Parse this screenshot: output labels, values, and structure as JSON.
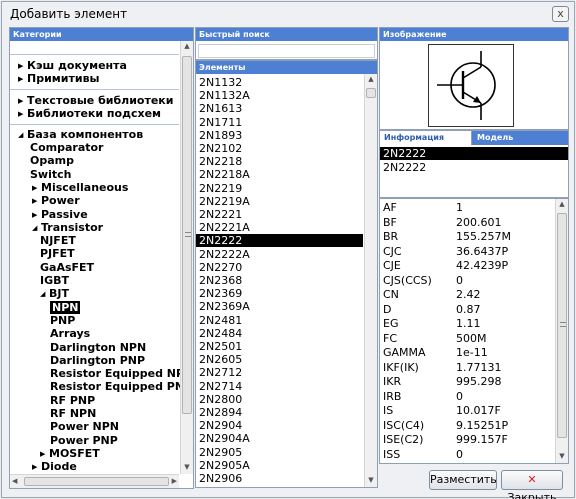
{
  "window": {
    "title": "Добавить элемент",
    "close_glyph": "x"
  },
  "categories": {
    "header": "Категории",
    "top_items": [
      {
        "label": "Кэш документа"
      },
      {
        "label": "Примитивы"
      },
      {
        "label": "Текстовые библиотеки"
      },
      {
        "label": "Библиотеки подсхем"
      }
    ],
    "root": {
      "label": "База компонентов"
    },
    "tree": [
      {
        "label": "Comparator",
        "arrow": ""
      },
      {
        "label": "Opamp",
        "arrow": ""
      },
      {
        "label": "Switch",
        "arrow": ""
      },
      {
        "label": "Miscellaneous",
        "arrow": "▶"
      },
      {
        "label": "Power",
        "arrow": "▶"
      },
      {
        "label": "Passive",
        "arrow": "▶"
      },
      {
        "label": "Transistor",
        "arrow": "◢"
      },
      {
        "label": "NJFET",
        "arrow": ""
      },
      {
        "label": "PJFET",
        "arrow": ""
      },
      {
        "label": "GaAsFET",
        "arrow": ""
      },
      {
        "label": "IGBT",
        "arrow": ""
      },
      {
        "label": "BJT",
        "arrow": "◢"
      },
      {
        "label": "NPN",
        "arrow": ""
      },
      {
        "label": "PNP",
        "arrow": ""
      },
      {
        "label": "Arrays",
        "arrow": ""
      },
      {
        "label": "Darlington NPN",
        "arrow": ""
      },
      {
        "label": "Darlington PNP",
        "arrow": ""
      },
      {
        "label": "Resistor Equipped NPN",
        "arrow": ""
      },
      {
        "label": "Resistor Equipped PNP",
        "arrow": ""
      },
      {
        "label": "RF PNP",
        "arrow": ""
      },
      {
        "label": "RF NPN",
        "arrow": ""
      },
      {
        "label": "Power NPN",
        "arrow": ""
      },
      {
        "label": "Power PNP",
        "arrow": ""
      },
      {
        "label": "MOSFET",
        "arrow": "▶"
      },
      {
        "label": "Diode",
        "arrow": "▶"
      }
    ]
  },
  "search": {
    "header": "Быстрый поиск",
    "value": ""
  },
  "elements": {
    "header": "Элементы",
    "selected": "2N2222",
    "items": [
      "2N1132",
      "2N1132A",
      "2N1613",
      "2N1711",
      "2N1893",
      "2N2102",
      "2N2218",
      "2N2218A",
      "2N2219",
      "2N2219A",
      "2N2221",
      "2N2221A",
      "2N2222",
      "2N2222A",
      "2N2270",
      "2N2368",
      "2N2369",
      "2N2369A",
      "2N2481",
      "2N2484",
      "2N2501",
      "2N2605",
      "2N2712",
      "2N2714",
      "2N2800",
      "2N2894",
      "2N2904",
      "2N2904A",
      "2N2905",
      "2N2905A",
      "2N2906"
    ]
  },
  "image": {
    "header": "Изображение",
    "icon": "npn-transistor-symbol"
  },
  "info": {
    "tabs": [
      {
        "label": "Информация"
      },
      {
        "label": "Модель"
      }
    ],
    "lines": [
      "2N2222",
      "2N2222"
    ]
  },
  "params": [
    {
      "k": "AF",
      "v": "1"
    },
    {
      "k": "BF",
      "v": "200.601"
    },
    {
      "k": "BR",
      "v": "155.257M"
    },
    {
      "k": "CJC",
      "v": "36.6437P"
    },
    {
      "k": "CJE",
      "v": "42.4239P"
    },
    {
      "k": "CJS(CCS)",
      "v": "0"
    },
    {
      "k": "CN",
      "v": "2.42"
    },
    {
      "k": "D",
      "v": "0.87"
    },
    {
      "k": "EG",
      "v": "1.11"
    },
    {
      "k": "FC",
      "v": "500M"
    },
    {
      "k": "GAMMA",
      "v": "1e-11"
    },
    {
      "k": "IKF(IK)",
      "v": "1.77131"
    },
    {
      "k": "IKR",
      "v": "995.298"
    },
    {
      "k": "IRB",
      "v": "0"
    },
    {
      "k": "IS",
      "v": "10.017F"
    },
    {
      "k": "ISC(C4)",
      "v": "9.15251P"
    },
    {
      "k": "ISE(C2)",
      "v": "999.157F"
    },
    {
      "k": "ISS",
      "v": "0"
    }
  ],
  "buttons": {
    "place": "Разместить",
    "close": "Закрыть",
    "close_glyph": "✕"
  },
  "colors": {
    "header": "#4d7fd3",
    "selection": "#000000",
    "close_x": "#d21f1f"
  }
}
